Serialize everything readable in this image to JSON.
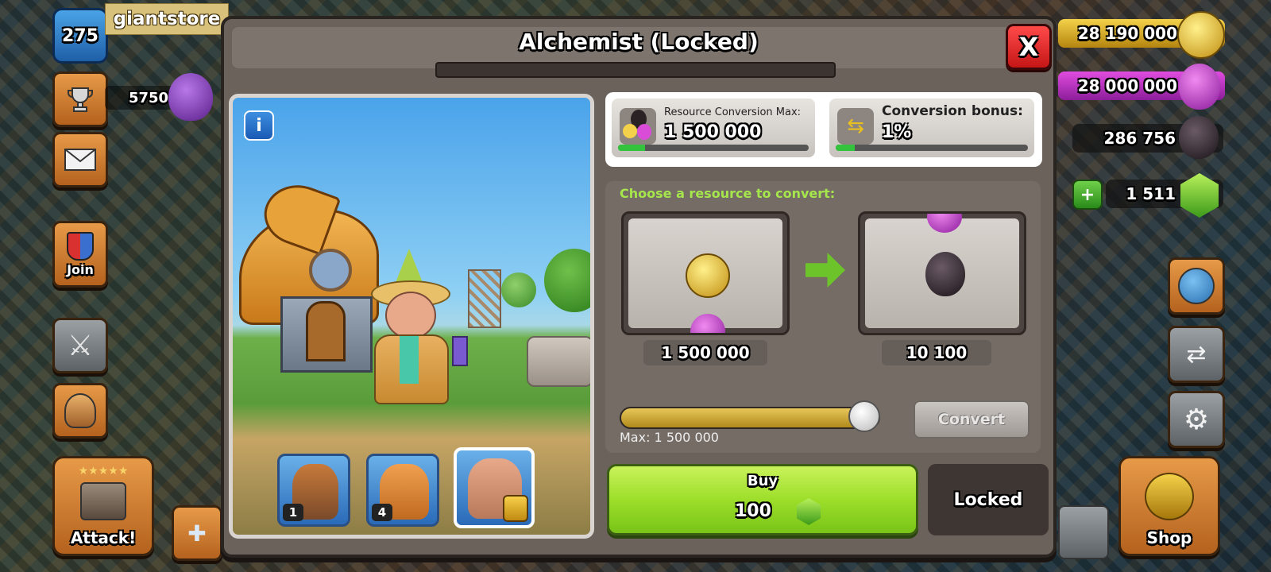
{
  "brand": {
    "text": "giantstore"
  },
  "hud_left": {
    "level": "275",
    "trophies": "5750",
    "join_label": "Join",
    "attack_label": "Attack!"
  },
  "hud_right": {
    "gold": "28 190 000",
    "elixir": "28 000 000",
    "dark_elixir": "286 756",
    "gems": "1 511",
    "shop_label": "Shop"
  },
  "dialog": {
    "title": "Alchemist (Locked)",
    "close_label": "X",
    "info_label": "i",
    "heroes": [
      {
        "name": "hero-1",
        "level": "1"
      },
      {
        "name": "hero-2",
        "level": "4"
      },
      {
        "name": "hero-3",
        "level": ""
      }
    ],
    "stats": {
      "max_label": "Resource Conversion Max:",
      "max_value": "1 500 000",
      "max_progress": 0.14,
      "bonus_label": "Conversion bonus:",
      "bonus_value": "1%",
      "bonus_progress": 0.1
    },
    "convert": {
      "prompt": "Choose a resource to convert:",
      "from_amount": "1 500 000",
      "to_amount": "10 100",
      "slider_fraction": 1.0,
      "max_text": "Max: 1 500 000",
      "convert_button": "Convert"
    },
    "buy": {
      "label": "Buy",
      "price": "100"
    },
    "locked_label": "Locked"
  },
  "colors": {
    "accent_green": "#9dde2a",
    "close_red": "#e02020",
    "prompt_green": "#a5e64c"
  }
}
